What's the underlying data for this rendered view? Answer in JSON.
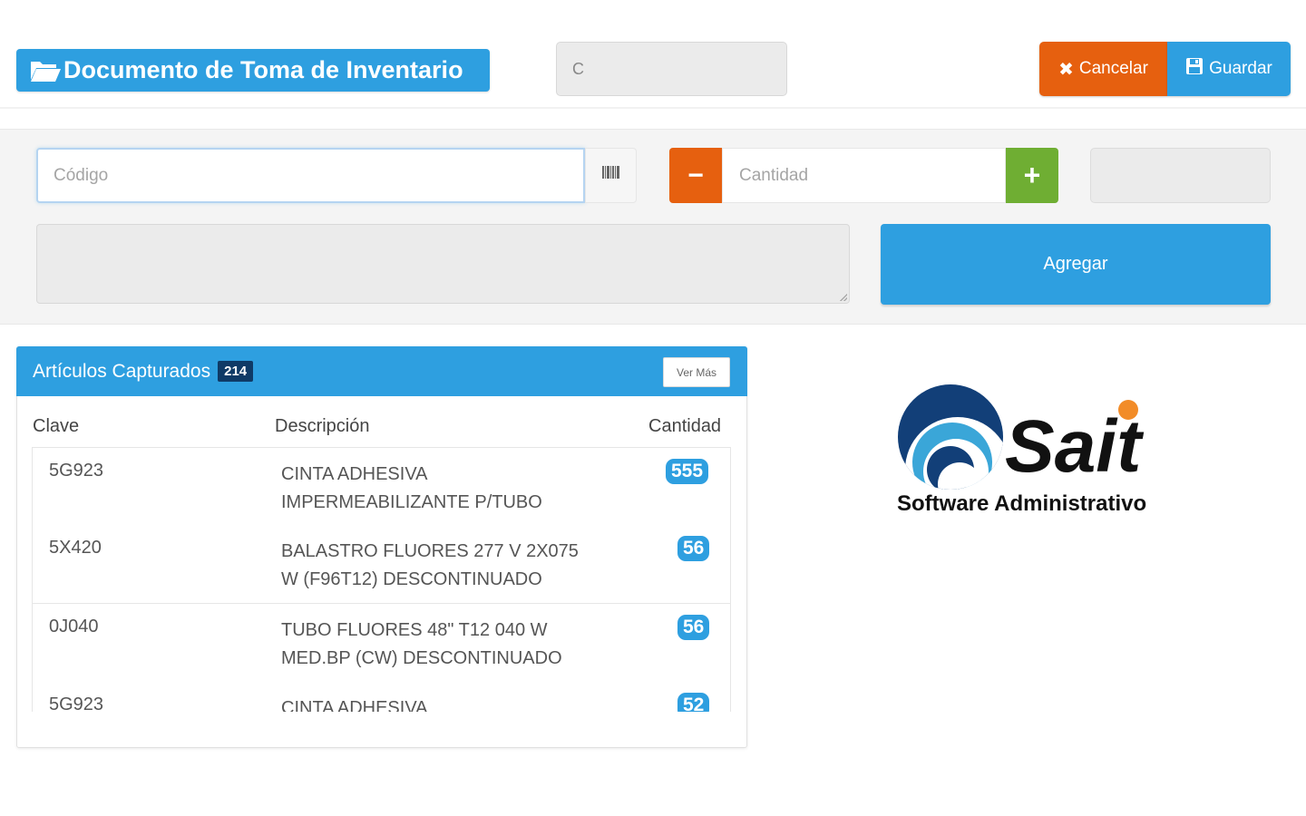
{
  "header": {
    "title": "Documento de Toma de Inventario",
    "document_value": "C",
    "cancel_label": "Cancelar",
    "save_label": "Guardar"
  },
  "form": {
    "codigo_placeholder": "Código",
    "cantidad_placeholder": "Cantidad",
    "minus_label": "−",
    "plus_label": "+",
    "add_label": "Agregar"
  },
  "articles": {
    "title": "Artículos Capturados",
    "count": "214",
    "more_label": "Ver Más",
    "columns": {
      "clave": "Clave",
      "descripcion": "Descripción",
      "cantidad": "Cantidad"
    },
    "rows": [
      {
        "clave": "5G923",
        "desc1": "CINTA ADHESIVA",
        "desc2": "IMPERMEABILIZANTE P/TUBO",
        "qty": "555"
      },
      {
        "clave": "5X420",
        "desc1": "BALASTRO FLUORES 277 V 2X075",
        "desc2": "W (F96T12) DESCONTINUADO",
        "qty": "56"
      },
      {
        "clave": "0J040",
        "desc1": "TUBO FLUORES 48\" T12 040 W",
        "desc2": "MED.BP (CW) DESCONTINUADO",
        "qty": "56"
      },
      {
        "clave": "5G923",
        "desc1": "CINTA ADHESIVA",
        "desc2": "",
        "qty": "52"
      }
    ]
  },
  "logo": {
    "name": "Sait",
    "tagline": "Software Administrativo"
  },
  "colors": {
    "primary": "#2e9fe0",
    "danger": "#e6600f",
    "success": "#6fae33",
    "badge_dark": "#0f3a66"
  }
}
